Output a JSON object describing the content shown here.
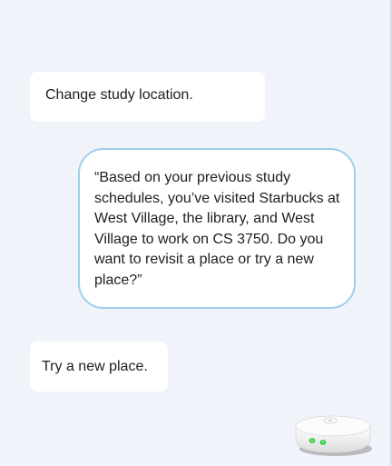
{
  "messages": [
    {
      "role": "user",
      "text": "Change study location."
    },
    {
      "role": "assistant",
      "text": "“Based on your previous study schedules, you’ve visited Starbucks at West Village, the library, and West Village to work on CS 3750. Do you want to revisit a place or try a new place?”"
    },
    {
      "role": "user",
      "text": "Try a new place."
    }
  ],
  "device": {
    "icon": "smart-speaker-icon",
    "indicator_color": "#3ee04a",
    "border_color": "#9cd0e9"
  }
}
